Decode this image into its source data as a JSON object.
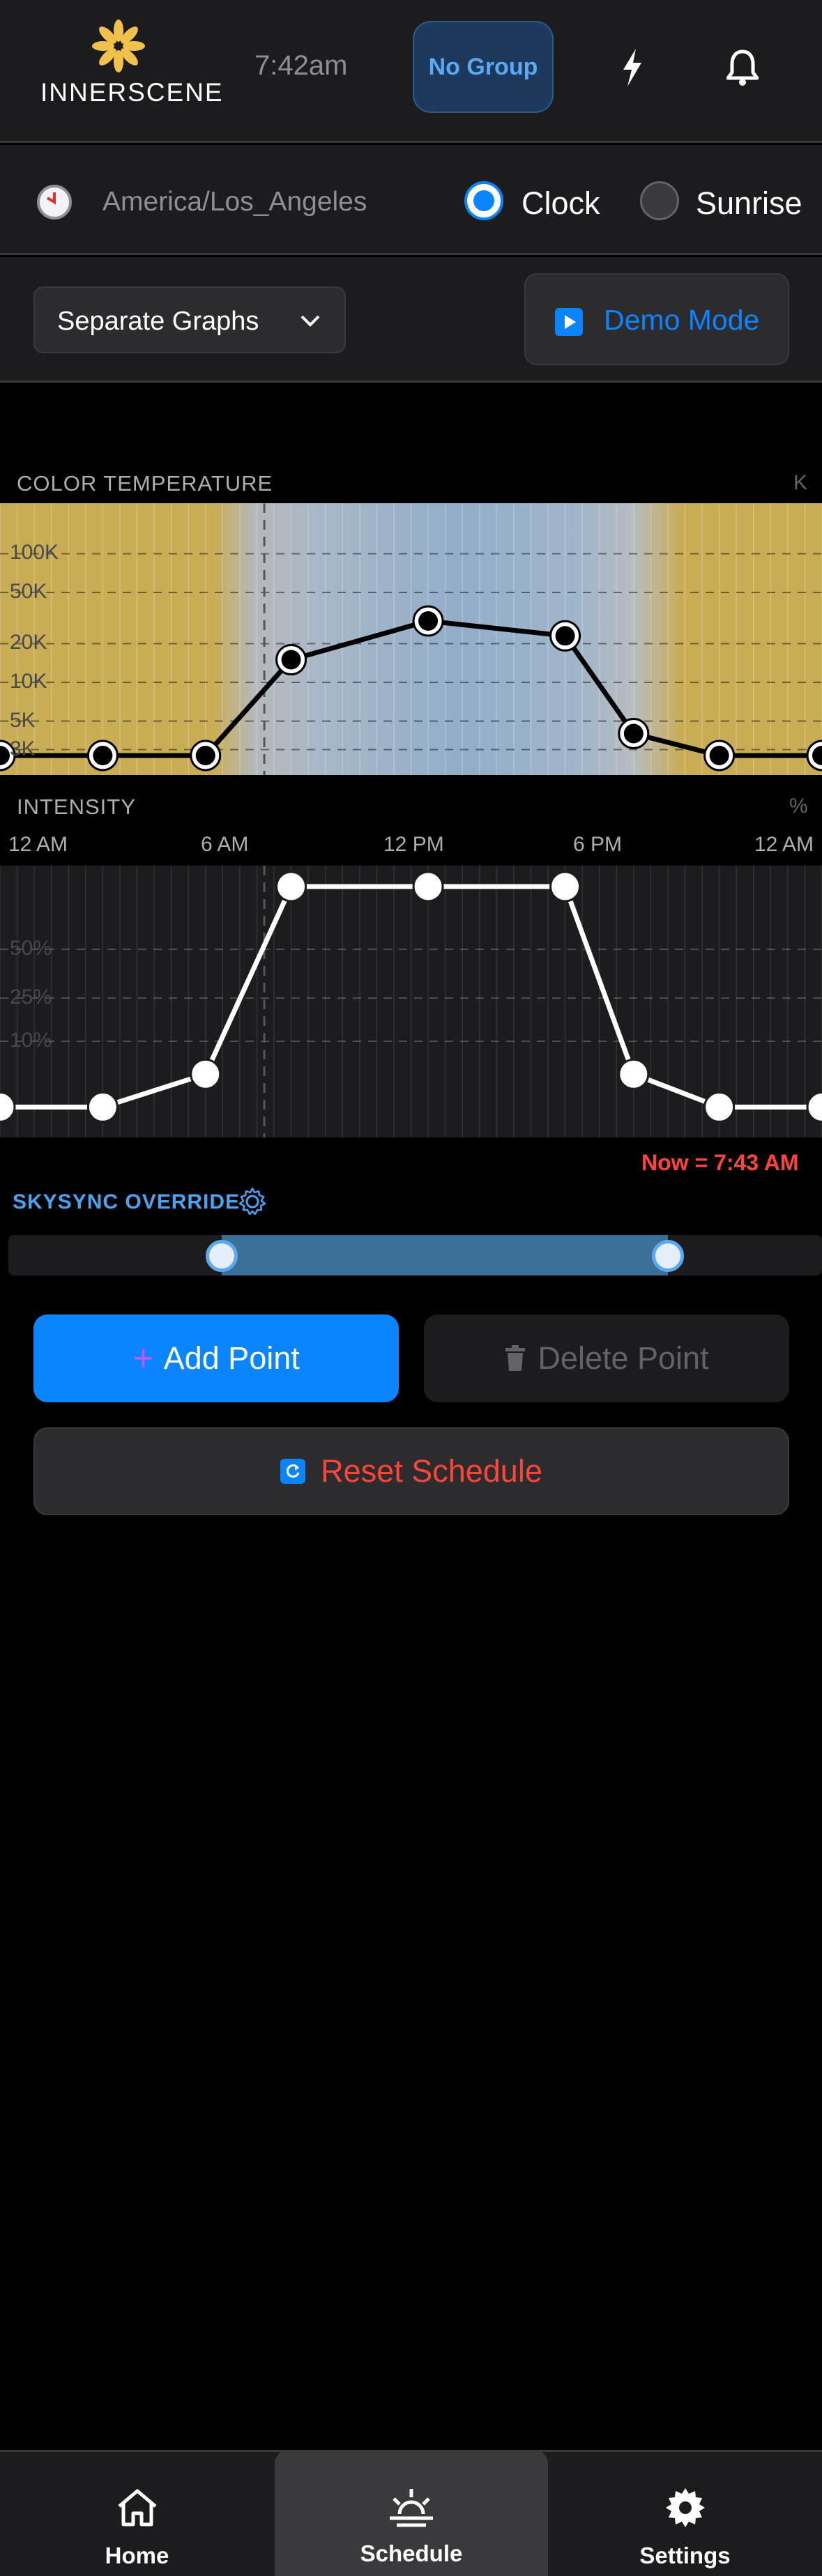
{
  "header": {
    "brand": "INNERSCENE",
    "time": "7:42am",
    "group_button": "No Group",
    "icons": [
      "lightning-icon",
      "bell-icon"
    ]
  },
  "timezone": {
    "value": "America/Los_Angeles",
    "modes": [
      {
        "label": "Clock",
        "selected": true
      },
      {
        "label": "Sunrise",
        "selected": false
      }
    ]
  },
  "controls": {
    "graph_mode": "Separate Graphs",
    "demo_mode": "Demo Mode"
  },
  "color_temp": {
    "label": "COLOR TEMPERATURE",
    "unit": "K",
    "y_ticks": [
      "100K",
      "50K",
      "20K",
      "10K",
      "5K",
      "3K"
    ]
  },
  "intensity": {
    "label": "INTENSITY",
    "unit": "%",
    "y_ticks": [
      "50%",
      "25%",
      "10%"
    ]
  },
  "x_axis": [
    "12 AM",
    "6 AM",
    "12 PM",
    "6 PM",
    "12 AM"
  ],
  "now_label": "Now = 7:43 AM",
  "skysync": {
    "label": "SKYSYNC OVERRIDE"
  },
  "actions": {
    "add_point": "Add Point",
    "delete_point": "Delete Point",
    "reset_schedule": "Reset Schedule"
  },
  "tabs": [
    {
      "label": "Home",
      "active": false
    },
    {
      "label": "Schedule",
      "active": true
    },
    {
      "label": "Settings",
      "active": false
    }
  ],
  "chart_data": [
    {
      "type": "line",
      "title": "COLOR TEMPERATURE",
      "ylabel": "K",
      "y_ticks": [
        "3K",
        "5K",
        "10K",
        "20K",
        "50K",
        "100K"
      ],
      "x_ticks": [
        "12 AM",
        "6 AM",
        "12 PM",
        "6 PM",
        "12 AM"
      ],
      "series": [
        {
          "x_hours": [
            0,
            3,
            6,
            8.5,
            12.5,
            16.5,
            18.5,
            21,
            24
          ],
          "y_k": [
            2700,
            2700,
            2700,
            15000,
            30000,
            23000,
            4000,
            2700,
            2700
          ]
        }
      ]
    },
    {
      "type": "line",
      "title": "INTENSITY",
      "ylabel": "%",
      "y_ticks": [
        "10%",
        "25%",
        "50%"
      ],
      "x_ticks": [
        "12 AM",
        "6 AM",
        "12 PM",
        "6 PM",
        "12 AM"
      ],
      "series": [
        {
          "x_hours": [
            0,
            3,
            6,
            8.5,
            12.5,
            16.5,
            18.5,
            21,
            24
          ],
          "y_pct": [
            2,
            2,
            6,
            100,
            100,
            100,
            6,
            2,
            2
          ]
        }
      ]
    }
  ]
}
